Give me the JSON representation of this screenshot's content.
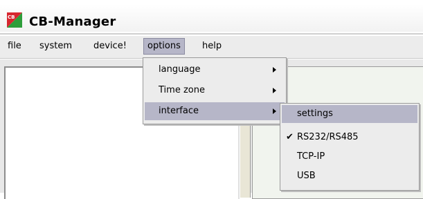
{
  "app": {
    "title": "CB-Manager",
    "logo_text": "CB"
  },
  "menubar": {
    "items": [
      {
        "label": "file"
      },
      {
        "label": "system"
      },
      {
        "label": "device!"
      },
      {
        "label": "options"
      },
      {
        "label": "help"
      }
    ]
  },
  "options_menu": {
    "items": [
      {
        "label": "language",
        "has_submenu": true
      },
      {
        "label": "Time zone",
        "has_submenu": true
      },
      {
        "label": "interface",
        "has_submenu": true,
        "highlighted": true
      }
    ]
  },
  "interface_submenu": {
    "items": [
      {
        "label": "settings",
        "highlighted": true
      },
      {
        "label": "RS232/RS485",
        "checked": true,
        "check_mark": "✔"
      },
      {
        "label": "TCP-IP"
      },
      {
        "label": "USB"
      }
    ]
  },
  "colors": {
    "menu_highlight": "#b6b6c8",
    "menu_background": "#ececec",
    "logo_green": "#2e9e3a",
    "logo_red": "#d7262f"
  }
}
